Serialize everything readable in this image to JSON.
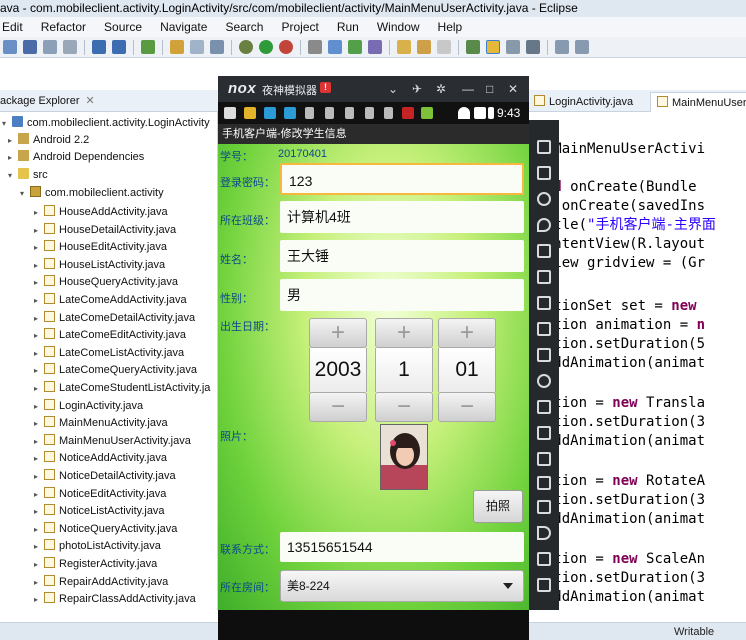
{
  "eclipse": {
    "window_title": "ava - com.mobileclient.activity.LoginActivity/src/com/mobileclient/activity/MainMenuUserActivity.java - Eclipse",
    "menu": [
      "Edit",
      "Refactor",
      "Source",
      "Navigate",
      "Search",
      "Project",
      "Run",
      "Window",
      "Help"
    ],
    "package_explorer": {
      "tab_label": "ackage Explorer",
      "project": "com.mobileclient.activity.LoginActivity",
      "android_lib": "Android 2.2",
      "android_deps": "Android Dependencies",
      "src_folder": "src",
      "package": "com.mobileclient.activity",
      "files": [
        "HouseAddActivity.java",
        "HouseDetailActivity.java",
        "HouseEditActivity.java",
        "HouseListActivity.java",
        "HouseQueryActivity.java",
        "LateComeAddActivity.java",
        "LateComeDetailActivity.java",
        "LateComeEditActivity.java",
        "LateComeListActivity.java",
        "LateComeQueryActivity.java",
        "LateComeStudentListActivity.ja",
        "LoginActivity.java",
        "MainMenuActivity.java",
        "MainMenuUserActivity.java",
        "NoticeAddActivity.java",
        "NoticeDetailActivity.java",
        "NoticeEditActivity.java",
        "NoticeListActivity.java",
        "NoticeQueryActivity.java",
        "photoListActivity.java",
        "RegisterActivity.java",
        "RepairAddActivity.java",
        "RepairClassAddActivity.java"
      ]
    },
    "editor_tabs": [
      "LoginActivity.java",
      "MainMenuUserAct"
    ],
    "status": {
      "writable": "Writable"
    }
  },
  "nox": {
    "logo": "nox",
    "name": "夜神模拟器",
    "badge": "!",
    "android_time": "9:43"
  },
  "app": {
    "title": "手机客户端-修改学生信息",
    "labels": {
      "student_id": "学号：",
      "password": "登录密码：",
      "class": "所在班级：",
      "name": "姓名：",
      "gender": "性别：",
      "birthdate": "出生日期：",
      "photo": "照片：",
      "contact": "联系方式：",
      "room": "所在房间："
    },
    "values": {
      "student_id": "20170401",
      "password": "123",
      "class": "计算机4班",
      "name": "王大锤",
      "gender": "男",
      "year": "2003",
      "month": "1",
      "day": "01",
      "contact": "13515651544",
      "room": "美8-224"
    },
    "picker": {
      "plus": "+",
      "minus": "−"
    },
    "photo_button": "拍照"
  }
}
